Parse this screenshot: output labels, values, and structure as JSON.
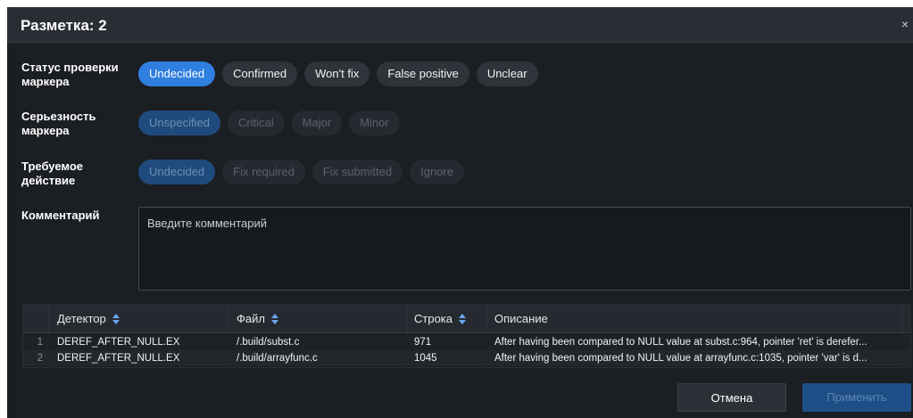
{
  "dialog": {
    "title": "Разметка: 2",
    "close_glyph": "×"
  },
  "status": {
    "label": "Статус проверки маркера",
    "options": [
      "Undecided",
      "Confirmed",
      "Won't fix",
      "False positive",
      "Unclear"
    ],
    "selected": "Undecided"
  },
  "severity": {
    "label": "Серьезность маркера",
    "options": [
      "Unspecified",
      "Critical",
      "Major",
      "Minor"
    ],
    "selected": "Unspecified",
    "enabled": false
  },
  "action": {
    "label": "Требуемое действие",
    "options": [
      "Undecided",
      "Fix required",
      "Fix submitted",
      "Ignore"
    ],
    "selected": "Undecided",
    "enabled": false
  },
  "comment": {
    "label": "Комментарий",
    "placeholder": "Введите комментарий",
    "value": ""
  },
  "table": {
    "columns": {
      "detector": "Детектор",
      "file": "Файл",
      "line": "Строка",
      "description": "Описание"
    },
    "rows": [
      {
        "num": "1",
        "detector": "DEREF_AFTER_NULL.EX",
        "file": "/.build/subst.c",
        "line": "971",
        "description": "After having been compared to NULL value at subst.c:964, pointer 'ret' is derefer..."
      },
      {
        "num": "2",
        "detector": "DEREF_AFTER_NULL.EX",
        "file": "/.build/arrayfunc.c",
        "line": "1045",
        "description": "After having been compared to NULL value at arrayfunc.c:1035, pointer 'var' is d..."
      }
    ]
  },
  "buttons": {
    "cancel": "Отмена",
    "apply": "Применить"
  },
  "colors": {
    "accent": "#2f7fe0",
    "background": "#1b1e22",
    "header": "#2a2e34"
  }
}
